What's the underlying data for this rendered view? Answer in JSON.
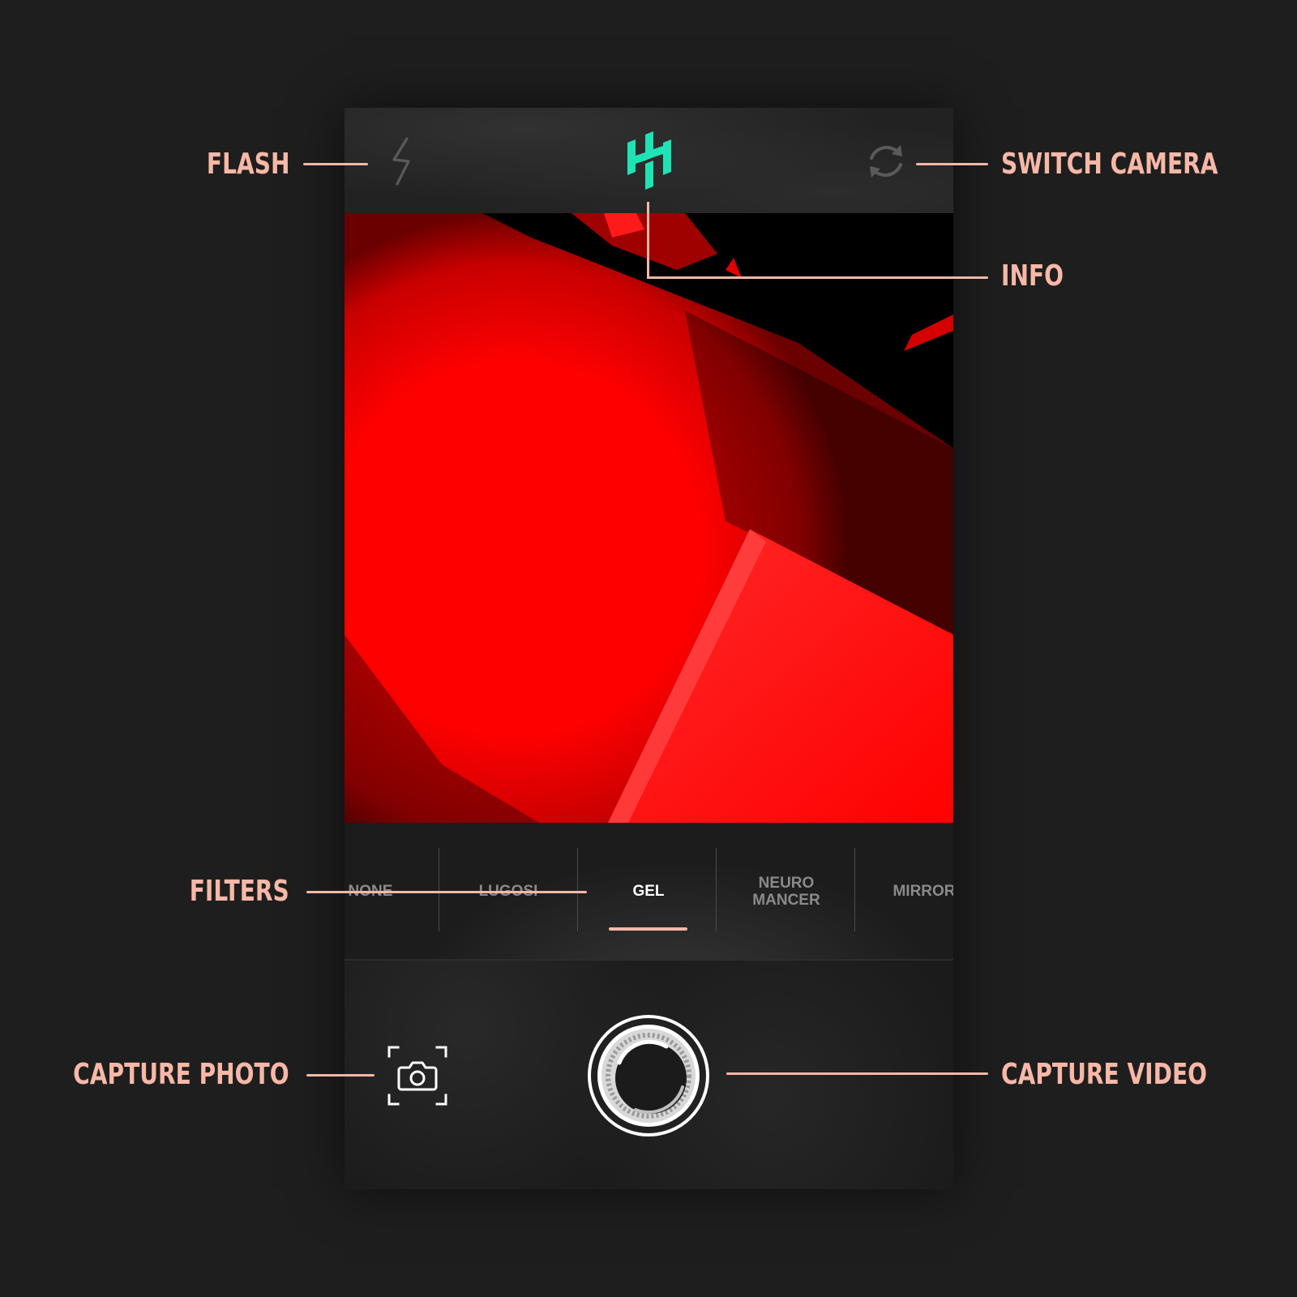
{
  "colors": {
    "background": "#1e1e1e",
    "annotation": "#f7b8a7",
    "logo": "#1ee3b4",
    "filter_active_underline": "#f7b8a7",
    "viewfinder_red": "#ff0000"
  },
  "top_bar": {
    "flash_icon": "lightning-bolt-icon",
    "logo_icon": "brand-logo-icon",
    "switch_icon": "rotate-arrows-icon"
  },
  "filters": {
    "items": [
      {
        "label": "NONE"
      },
      {
        "label": "LUGOSI"
      },
      {
        "label": "GEL"
      },
      {
        "label": "NEURO\nMANCER"
      },
      {
        "label": "MIRROR"
      }
    ],
    "selected": "GEL"
  },
  "bottom_bar": {
    "photo_icon": "camera-viewfinder-icon",
    "video_icon": "record-ring-icon"
  },
  "annotations": {
    "flash": "FLASH",
    "switch_camera": "SWITCH CAMERA",
    "info": "INFO",
    "filters": "FILTERS",
    "capture_photo": "CAPTURE PHOTO",
    "capture_video": "CAPTURE VIDEO"
  }
}
